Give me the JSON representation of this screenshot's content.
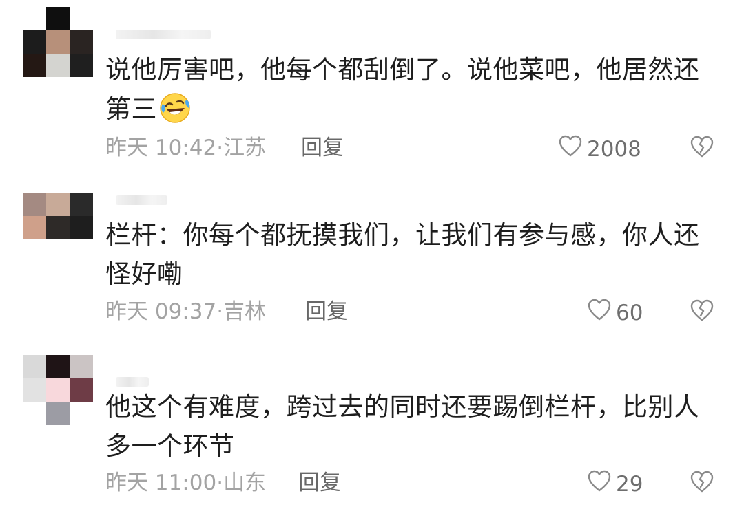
{
  "comments": [
    {
      "text": "说他厉害吧，他每个都刮倒了。说他菜吧，他居然还第三",
      "emoji": "rolling-on-floor-laughing-icon",
      "time": "昨天 10:42",
      "location": "江苏",
      "reply_label": "回复",
      "likes": "2008",
      "avatar_colors": [
        "#ffffff",
        "#0f0f0f",
        "#ffffff",
        "#1c1c1c",
        "#b7907a",
        "#2a2422",
        "#241814",
        "#d4d4d0",
        "#1f1f1f"
      ]
    },
    {
      "text": "栏杆：你每个都抚摸我们，让我们有参与感，你人还怪好嘞",
      "time": "昨天 09:37",
      "location": "吉林",
      "reply_label": "回复",
      "likes": "60",
      "avatar_colors": [
        "#a48a82",
        "#c8aa98",
        "#2a2a2a",
        "#cfa08a",
        "#2e2a28",
        "#1e1e1e",
        "#ffffff",
        "#ffffff",
        "#ffffff"
      ]
    },
    {
      "text": "他这个有难度，跨过去的同时还要踢倒栏杆，比别人多一个环节",
      "time": "昨天 11:00",
      "location": "山东",
      "reply_label": "回复",
      "likes": "29",
      "avatar_colors": [
        "#d9d9d9",
        "#1f1416",
        "#cbc4c4",
        "#e2e2e2",
        "#f8d8dc",
        "#6e3c46",
        "#ffffff",
        "#9c9ca4",
        "#ffffff"
      ]
    }
  ],
  "colors": {
    "text": "#1e1e1e",
    "meta": "#a3a3a3",
    "reply": "#686868",
    "icon": "#888888"
  }
}
